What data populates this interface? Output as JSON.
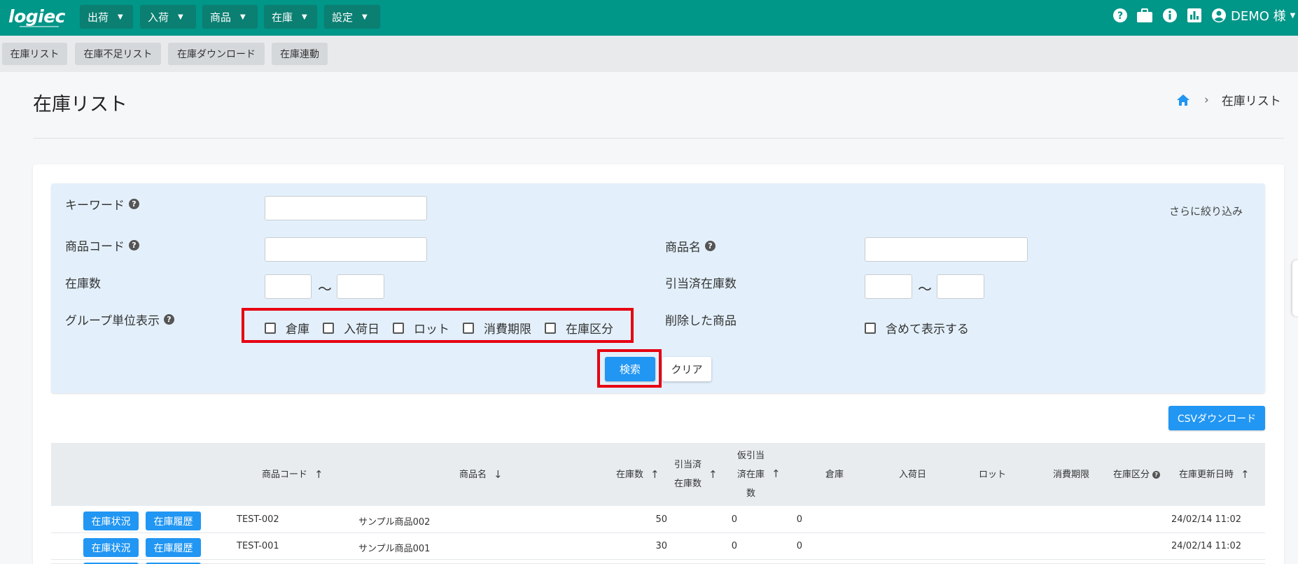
{
  "app": {
    "logo": "logiec"
  },
  "nav": {
    "items": [
      {
        "label": "出荷"
      },
      {
        "label": "入荷"
      },
      {
        "label": "商品"
      },
      {
        "label": "在庫"
      },
      {
        "label": "設定"
      }
    ],
    "user": "DEMO 様"
  },
  "subnav": {
    "items": [
      {
        "label": "在庫リスト"
      },
      {
        "label": "在庫不足リスト"
      },
      {
        "label": "在庫ダウンロード"
      },
      {
        "label": "在庫連動"
      }
    ]
  },
  "page": {
    "title": "在庫リスト"
  },
  "breadcrumb": {
    "current": "在庫リスト"
  },
  "search": {
    "keyword_label": "キーワード",
    "more_filter": "さらに絞り込み",
    "product_code_label": "商品コード",
    "product_name_label": "商品名",
    "stock_qty_label": "在庫数",
    "allocated_qty_label": "引当済在庫数",
    "range_sep": "～",
    "group_label": "グループ単位表示",
    "group_options": [
      "倉庫",
      "入荷日",
      "ロット",
      "消費期限",
      "在庫区分"
    ],
    "deleted_label": "削除した商品",
    "deleted_option": "含めて表示する",
    "search_button": "検索",
    "clear_button": "クリア"
  },
  "csv_button": "CSVダウンロード",
  "table": {
    "headers": {
      "product_code": "商品コード",
      "product_name": "商品名",
      "stock_qty": "在庫数",
      "allocated_1": "引当済",
      "allocated_2": "在庫数",
      "provisional_1": "仮引当",
      "provisional_2": "済在庫",
      "provisional_3": "数",
      "warehouse": "倉庫",
      "arrival_date": "入荷日",
      "lot": "ロット",
      "expiry": "消費期限",
      "stock_type": "在庫区分",
      "updated_at": "在庫更新日時"
    },
    "row_buttons": {
      "status": "在庫状況",
      "history": "在庫履歴"
    },
    "rows": [
      {
        "code": "TEST-002",
        "name": "サンプル商品002",
        "stock": "50",
        "allocated": "0",
        "provisional": "0",
        "updated": "24/02/14 11:02"
      },
      {
        "code": "TEST-001",
        "name": "サンプル商品001",
        "stock": "30",
        "allocated": "0",
        "provisional": "0",
        "updated": "24/02/14 11:02"
      }
    ]
  },
  "colors": {
    "nav": "#009688",
    "primary": "#2196f3",
    "highlight": "#e60012",
    "panel": "#e3f0fb"
  }
}
